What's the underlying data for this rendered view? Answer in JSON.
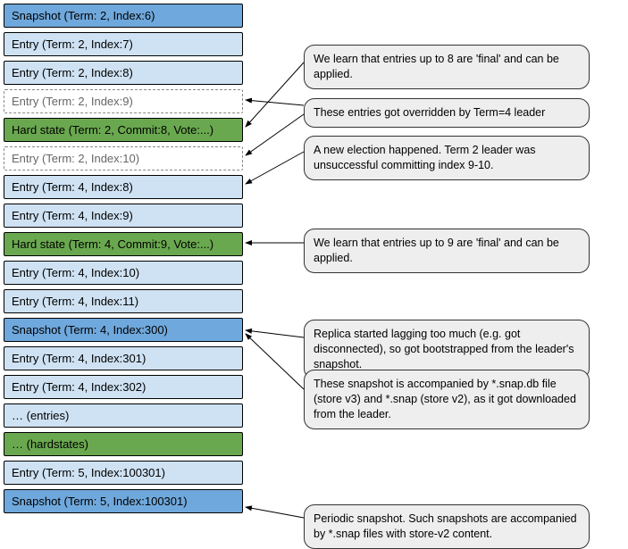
{
  "rows": [
    {
      "label": "Snapshot (Term: 2, Index:6)",
      "kind": "snapshot"
    },
    {
      "label": "Entry (Term: 2, Index:7)",
      "kind": "entry"
    },
    {
      "label": "Entry (Term: 2, Index:8)",
      "kind": "entry"
    },
    {
      "label": "Entry (Term: 2, Index:9)",
      "kind": "dashed"
    },
    {
      "label": "Hard state (Term: 2, Commit:8, Vote:...)",
      "kind": "hard"
    },
    {
      "label": "Entry (Term: 2, Index:10)",
      "kind": "dashed"
    },
    {
      "label": "Entry (Term: 4, Index:8)",
      "kind": "entry"
    },
    {
      "label": "Entry (Term: 4, Index:9)",
      "kind": "entry"
    },
    {
      "label": "Hard state (Term: 4, Commit:9, Vote:...)",
      "kind": "hard"
    },
    {
      "label": "Entry (Term: 4, Index:10)",
      "kind": "entry"
    },
    {
      "label": "Entry (Term: 4, Index:11)",
      "kind": "entry"
    },
    {
      "label": "Snapshot (Term: 4, Index:300)",
      "kind": "snapshot"
    },
    {
      "label": "Entry (Term: 4, Index:301)",
      "kind": "entry"
    },
    {
      "label": "Entry (Term: 4, Index:302)",
      "kind": "entry"
    },
    {
      "label": "… (entries)",
      "kind": "entry"
    },
    {
      "label": "… (hardstates)",
      "kind": "hard"
    },
    {
      "label": "Entry (Term: 5, Index:100301)",
      "kind": "entry"
    },
    {
      "label": "Snapshot (Term: 5, Index:100301)",
      "kind": "snapshot"
    }
  ],
  "callouts": {
    "c1": "We learn that entries up to 8 are 'final' and can be applied.",
    "c2": "These entries got overridden by Term=4 leader",
    "c3": "A new election happened. Term 2 leader was unsuccessful committing index 9-10.",
    "c4": "We learn that entries up to 9 are 'final' and can be applied.",
    "c5": "Replica started lagging too much (e.g. got disconnected), so got bootstrapped from the leader's snapshot.",
    "c6": "These snapshot is accompanied by *.snap.db file (store v3) and *.snap (store v2), as it got downloaded from the leader.",
    "c7": "Periodic snapshot. Such snapshots are accompanied by *.snap files with store-v2 content."
  }
}
